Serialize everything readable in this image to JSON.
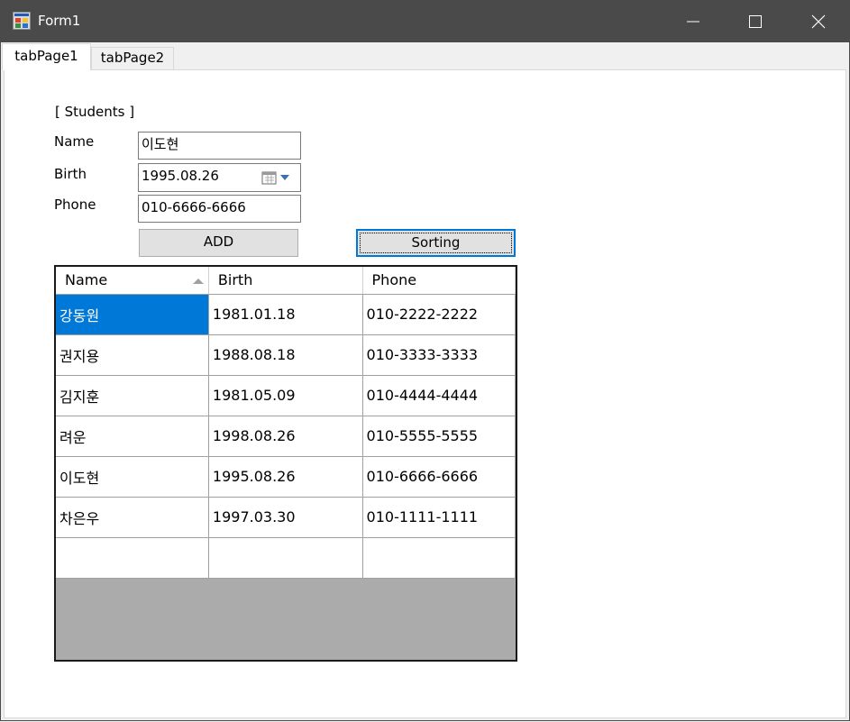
{
  "window": {
    "title": "Form1",
    "icon": "winforms-app-icon",
    "controls": [
      "minimize-icon",
      "maximize-icon",
      "close-icon"
    ]
  },
  "tabs": [
    {
      "label": "tabPage1",
      "selected": true
    },
    {
      "label": "tabPage2",
      "selected": false
    }
  ],
  "form": {
    "section_title": "[ Students ]",
    "name_label": "Name",
    "name_value": "이도현",
    "birth_label": "Birth",
    "birth_value": "1995.08.26",
    "phone_label": "Phone",
    "phone_value": "010-6666-6666",
    "add_button": "ADD",
    "sort_button": "Sorting"
  },
  "grid": {
    "columns": [
      "Name",
      "Birth",
      "Phone"
    ],
    "sorted_column": "Name",
    "sort_direction": "ascending",
    "rows": [
      [
        "강동원",
        "1981.01.18",
        "010-2222-2222"
      ],
      [
        "권지용",
        "1988.08.18",
        "010-3333-3333"
      ],
      [
        "김지훈",
        "1981.05.09",
        "010-4444-4444"
      ],
      [
        "려운",
        "1998.08.26",
        "010-5555-5555"
      ],
      [
        "이도현",
        "1995.08.26",
        "010-6666-6666"
      ],
      [
        "차은우",
        "1997.03.30",
        "010-1111-1111"
      ]
    ],
    "selected_cell": [
      0,
      0
    ],
    "colors": {
      "selection": "#0078d7",
      "empty_area": "#ababab"
    }
  }
}
